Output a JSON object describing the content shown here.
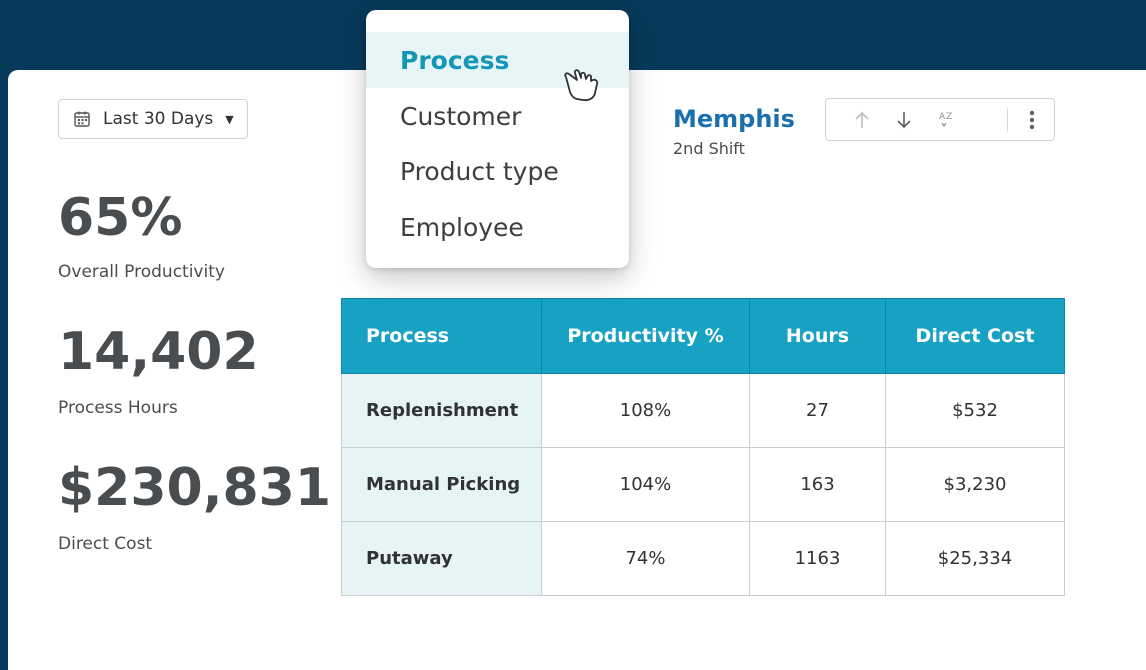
{
  "dateFilter": {
    "label": "Last 30 Days",
    "icon": "calendar-icon",
    "caret": "▼"
  },
  "stats": [
    {
      "value": "65%",
      "label": "Overall Productivity"
    },
    {
      "value": "14,402",
      "label": "Process Hours"
    },
    {
      "value": "$230,831",
      "label": "Direct Cost"
    }
  ],
  "location": {
    "name": "Memphis",
    "shift": "2nd Shift"
  },
  "toolbar": {
    "icons": [
      "arrow-up-icon",
      "arrow-down-icon",
      "sort-az-icon",
      "more-vertical-icon"
    ]
  },
  "groupByMenu": {
    "items": [
      "Process",
      "Customer",
      "Product type",
      "Employee"
    ],
    "selected": "Process"
  },
  "table": {
    "columns": [
      "Process",
      "Productivity %",
      "Hours",
      "Direct Cost"
    ],
    "rows": [
      [
        "Replenishment",
        "108%",
        "27",
        "$532"
      ],
      [
        "Manual Picking",
        "104%",
        "163",
        "$3,230"
      ],
      [
        "Putaway",
        "74%",
        "1163",
        "$25,334"
      ]
    ]
  },
  "colors": {
    "background": "#073a5a",
    "accent": "#17a2c4",
    "locationTitle": "#1a6fae",
    "rowHeader": "#e7f4f6"
  }
}
